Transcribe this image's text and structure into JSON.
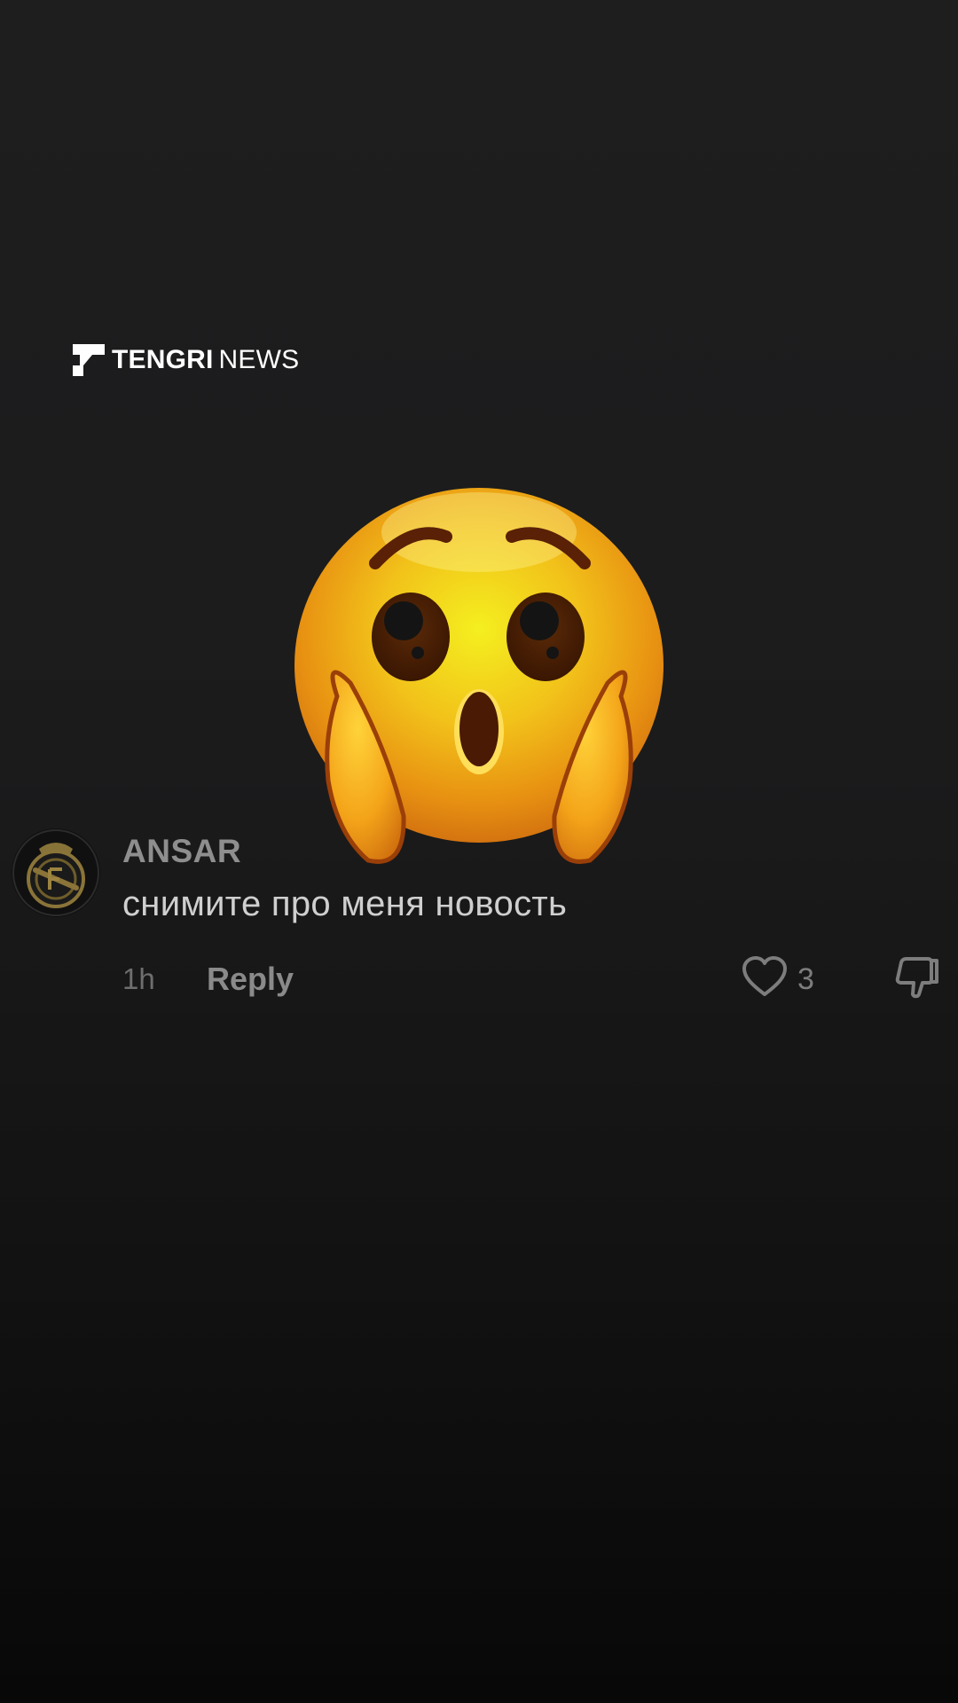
{
  "brand": {
    "name_bold": "TENGRI",
    "name_light": "NEWS",
    "logo_icon": "tengri-logo-icon",
    "color": "#ffffff"
  },
  "sticker": {
    "icon": "face-screaming-hands-on-cheeks-emoji"
  },
  "comment": {
    "avatar_icon": "real-madrid-crest-avatar",
    "username": "ANSAR",
    "text": "снимите про меня новость",
    "time": "1h",
    "reply_label": "Reply",
    "like_icon": "heart-outline-icon",
    "like_count": "3",
    "dislike_icon": "thumbs-down-icon"
  },
  "colors": {
    "background_top": "#1e1e1f",
    "background_bottom": "#080808",
    "username": "#8e8e8e",
    "comment_text": "#cfcfcf",
    "meta_text": "#6e6e6e"
  }
}
